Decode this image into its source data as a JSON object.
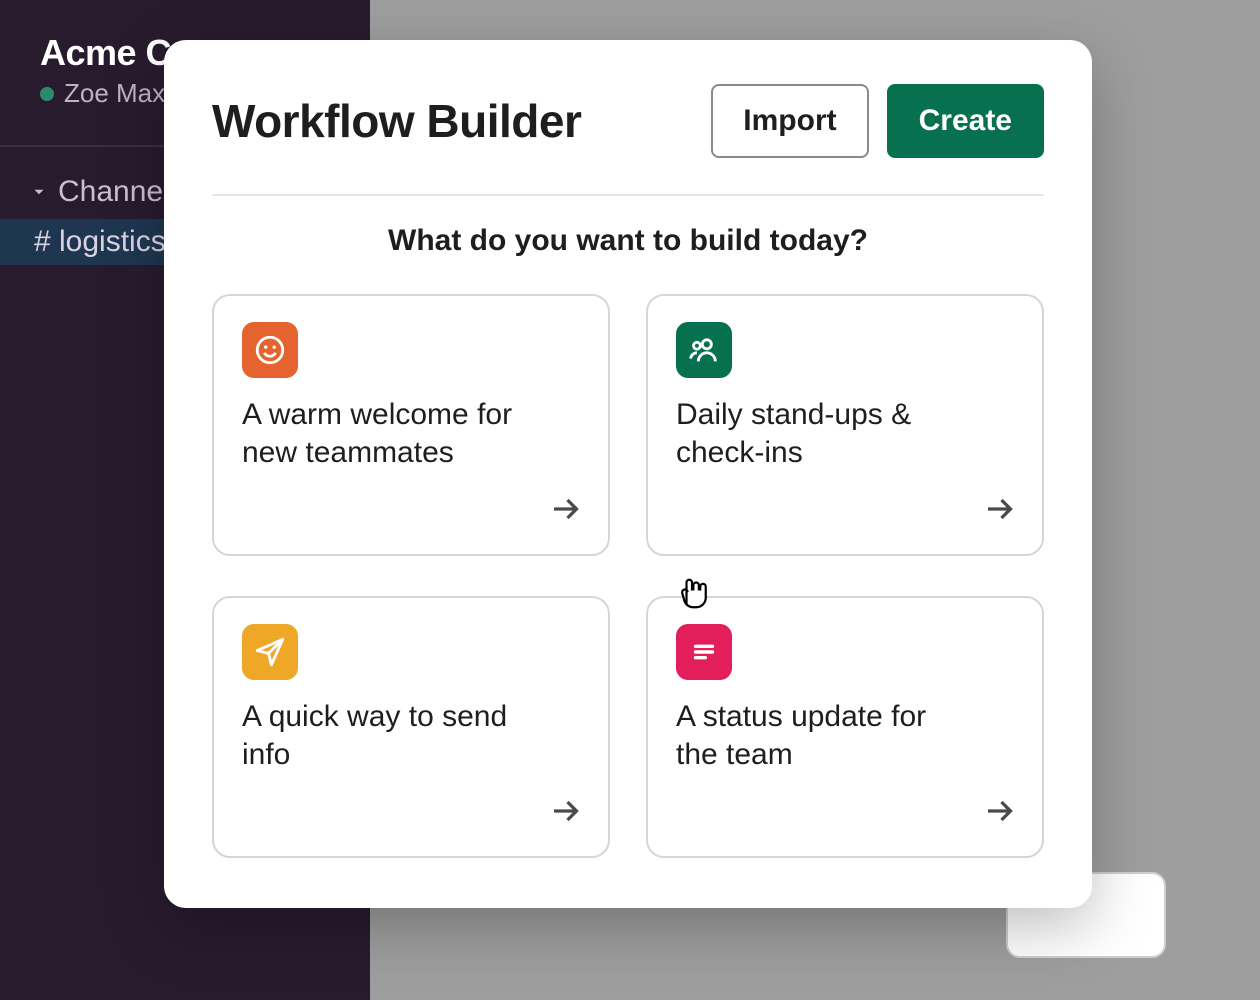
{
  "sidebar": {
    "workspace_name": "Acme Co",
    "user_name": "Zoe Max",
    "channels_label": "Channels",
    "active_channel": "# logistics"
  },
  "modal": {
    "title": "Workflow Builder",
    "import_label": "Import",
    "create_label": "Create",
    "subtitle": "What do you want to build today?",
    "cards": [
      {
        "title": "A warm welcome for new teammates",
        "icon": "smiley-icon",
        "color": "orange"
      },
      {
        "title": "Daily stand-ups & check-ins",
        "icon": "people-icon",
        "color": "green"
      },
      {
        "title": "A quick way to send info",
        "icon": "paperplane-icon",
        "color": "yellow"
      },
      {
        "title": "A status update for the team",
        "icon": "doc-lines-icon",
        "color": "pink"
      }
    ]
  },
  "colors": {
    "brand_green": "#07714f",
    "sidebar_bg": "#281b2e",
    "card_orange": "#e5632e",
    "card_yellow": "#efa728",
    "card_pink": "#e21e5b"
  }
}
